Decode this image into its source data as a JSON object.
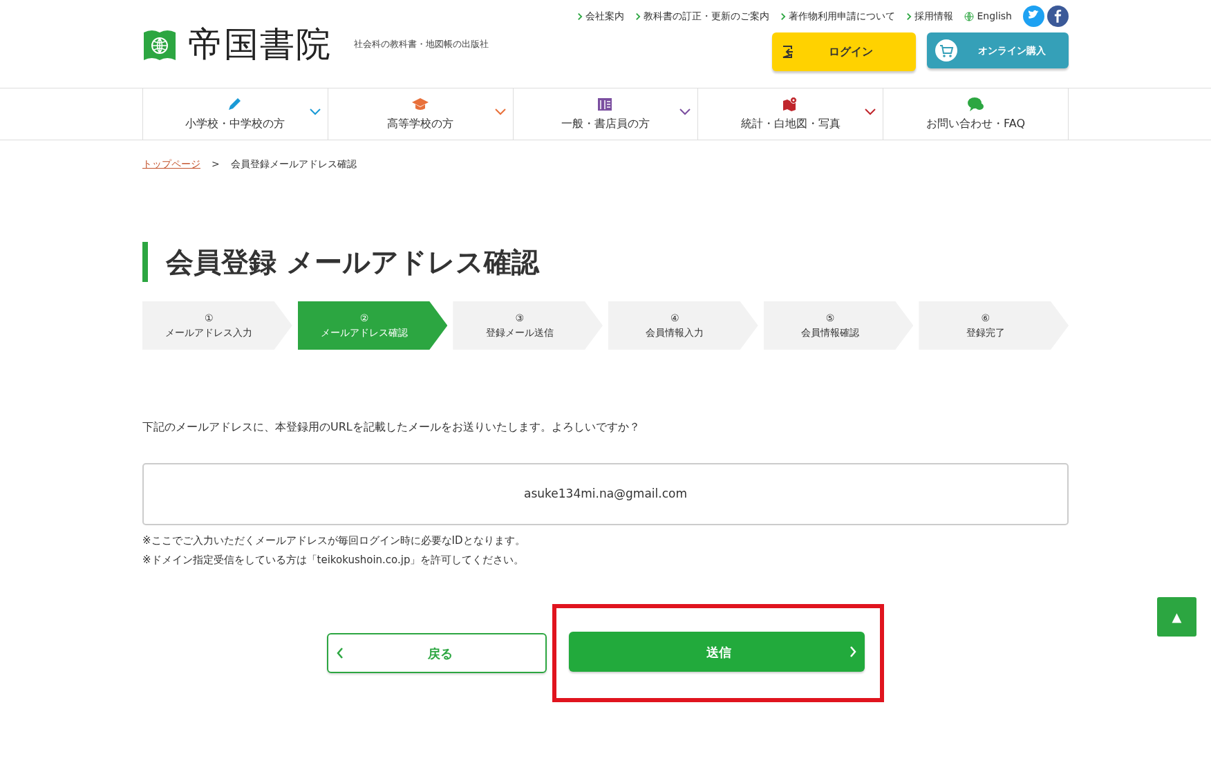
{
  "header": {
    "logo_text": "帝国書院",
    "tagline": "社会科の教科書・地図帳の出版社",
    "top_links": [
      {
        "kind": "chevron",
        "label": "会社案内"
      },
      {
        "kind": "chevron",
        "label": "教科書の訂正・更新のご案内"
      },
      {
        "kind": "chevron",
        "label": "著作物利用申請について"
      },
      {
        "kind": "chevron",
        "label": "採用情報"
      },
      {
        "kind": "globe",
        "label": "English"
      }
    ],
    "social": [
      {
        "kind": "twitter",
        "color": "#1da1f2"
      },
      {
        "kind": "facebook",
        "color": "#3b5998"
      }
    ],
    "login_button": "ログイン",
    "shop_button": "オンライン購入"
  },
  "nav": [
    {
      "kind": "pencil",
      "label": "小学校・中学校の方",
      "color": "#1a9ad6",
      "dropdown": true
    },
    {
      "kind": "cap",
      "label": "高等学校の方",
      "color": "#e8703a",
      "dropdown": true
    },
    {
      "kind": "book",
      "label": "一般・書店員の方",
      "color": "#7b4fa0",
      "dropdown": true
    },
    {
      "kind": "map",
      "label": "統計・白地図・写真",
      "color": "#c0262c",
      "dropdown": true
    },
    {
      "kind": "chat",
      "label": "お問い合わせ・FAQ",
      "color": "#2ca641",
      "dropdown": false
    }
  ],
  "breadcrumb": [
    {
      "label": "トップページ",
      "link": true
    },
    {
      "label": ">",
      "link": false
    },
    {
      "label": "会員登録メールアドレス確認",
      "link": false
    }
  ],
  "title": "会員登録 メールアドレス確認",
  "steps": [
    {
      "number": "①",
      "label": "メールアドレス入力",
      "selected": false
    },
    {
      "number": "②",
      "label": "メールアドレス確認",
      "selected": true
    },
    {
      "number": "③",
      "label": "登録メール送信",
      "selected": false
    },
    {
      "number": "④",
      "label": "会員情報入力",
      "selected": false
    },
    {
      "number": "⑤",
      "label": "会員情報確認",
      "selected": false
    },
    {
      "number": "⑥",
      "label": "登録完了",
      "selected": false
    }
  ],
  "message": "下記のメールアドレスに、本登録用のURLを記載したメールをお送りいたします。よろしいですか？",
  "email": "asuke134mi.na@gmail.com",
  "notes": [
    "※ここでご入力いただくメールアドレスが毎回ログイン時に必要なIDとなります。",
    "※ドメイン指定受信をしている方は「teikokushoin.co.jp」を許可してください。"
  ],
  "back_button": "戻る",
  "submit_button": "送信",
  "submit_highlighted": true,
  "page_top_button": "▲"
}
